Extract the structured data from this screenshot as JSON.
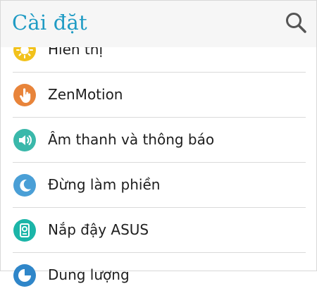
{
  "header": {
    "title": "Cài đặt",
    "search_icon": "search-icon"
  },
  "colors": {
    "accent": "#1f9bc4",
    "display": "#f2c21b",
    "zenmotion": "#e8843a",
    "sound": "#3ab8aa",
    "dnd": "#4a9fd6",
    "cover": "#1bb5a8",
    "storage": "#2f86c9"
  },
  "settings": {
    "items": [
      {
        "label": "Hiển thị",
        "icon": "brightness-icon"
      },
      {
        "label": "ZenMotion",
        "icon": "hand-gesture-icon"
      },
      {
        "label": "Âm thanh và thông báo",
        "icon": "speaker-icon"
      },
      {
        "label": "Đừng làm phiền",
        "icon": "moon-icon"
      },
      {
        "label": "Nắp đậy ASUS",
        "icon": "cover-icon"
      },
      {
        "label": "Dung lượng",
        "icon": "storage-icon"
      }
    ]
  }
}
